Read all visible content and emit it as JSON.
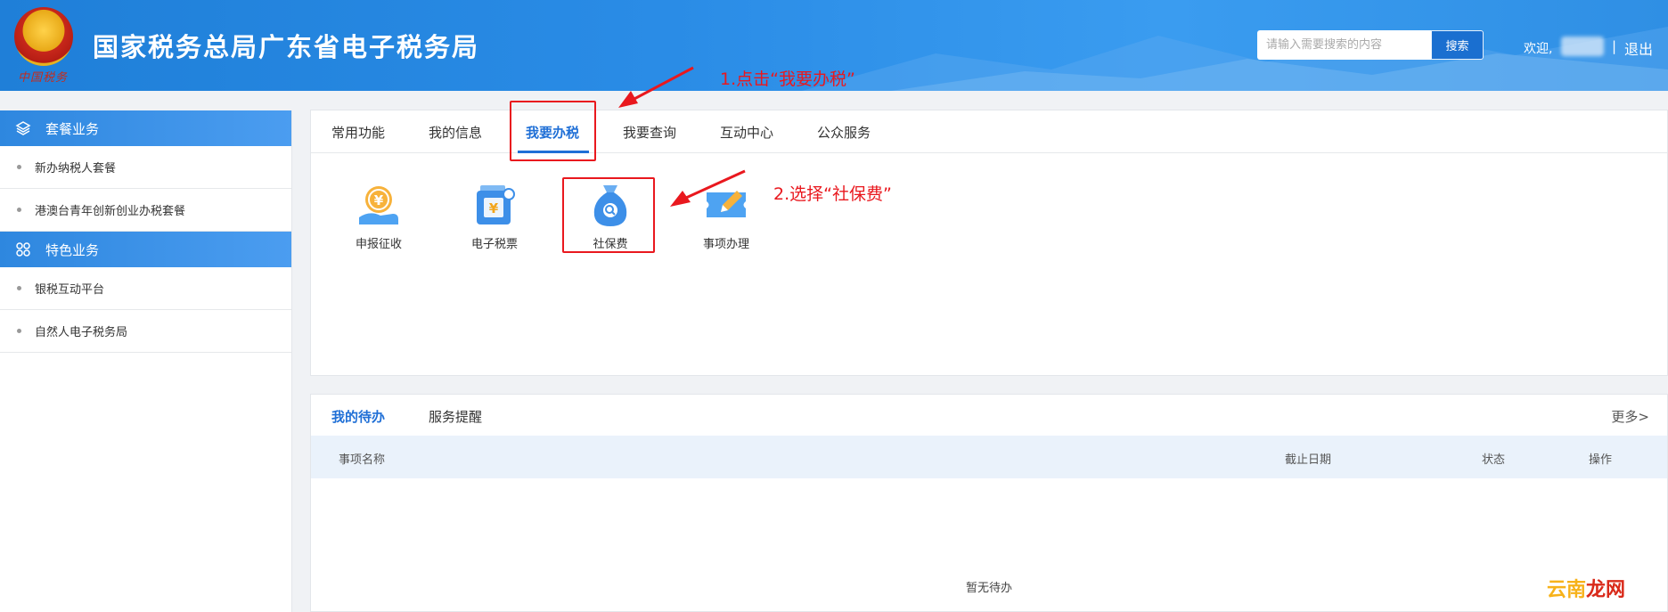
{
  "header": {
    "title": "国家税务总局广东省电子税务局",
    "emblem_caption": "中国税务",
    "search_placeholder": "请输入需要搜索的内容",
    "search_button": "搜索",
    "welcome": "欢迎,",
    "separator": "|",
    "logout": "退出"
  },
  "sidebar": {
    "sections": [
      {
        "title": "套餐业务",
        "icon": "layers-icon",
        "items": [
          "新办纳税人套餐",
          "港澳台青年创新创业办税套餐"
        ]
      },
      {
        "title": "特色业务",
        "icon": "grid-circles-icon",
        "items": [
          "银税互动平台",
          "自然人电子税务局"
        ]
      }
    ]
  },
  "main": {
    "tabs": [
      "常用功能",
      "我的信息",
      "我要办税",
      "我要查询",
      "互动中心",
      "公众服务"
    ],
    "active_tab": "我要办税",
    "functions": [
      {
        "label": "申报征收",
        "icon": "yuan-hand-icon"
      },
      {
        "label": "电子税票",
        "icon": "tax-ticket-icon"
      },
      {
        "label": "社保费",
        "icon": "money-bag-icon"
      },
      {
        "label": "事项办理",
        "icon": "edit-ticket-icon"
      }
    ]
  },
  "todo": {
    "tabs": [
      "我的待办",
      "服务提醒"
    ],
    "more": "更多>",
    "columns": [
      "事项名称",
      "截止日期",
      "状态",
      "操作"
    ],
    "empty_text": "暂无待办"
  },
  "annotations": {
    "step1": "1.点击“我要办税”",
    "step2": "2.选择“社保费”"
  },
  "watermark": {
    "part1": "云南",
    "part2": "龙网"
  },
  "colors": {
    "brand_blue": "#1f6fd6",
    "annotation_red": "#e9181e"
  }
}
